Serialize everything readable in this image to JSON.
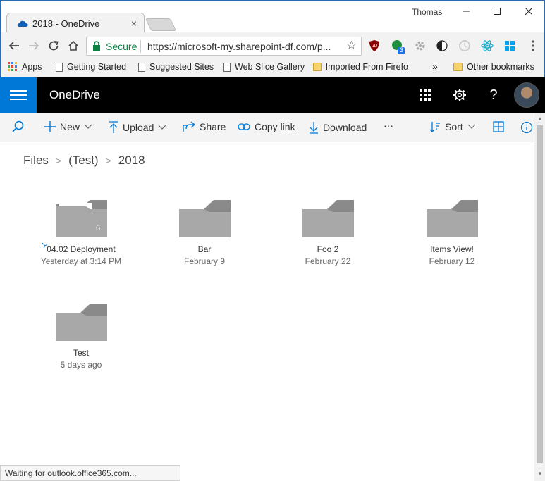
{
  "browser": {
    "tab_title": "2018 - OneDrive",
    "tab_close": "×",
    "user_name": "Thomas",
    "secure_label": "Secure",
    "url": "https://microsoft-my.sharepoint-df.com/p...",
    "bookmarks": [
      {
        "label": "Apps",
        "icon": "apps-grid-icon"
      },
      {
        "label": "Getting Started",
        "icon": "page-icon"
      },
      {
        "label": "Suggested Sites",
        "icon": "page-icon"
      },
      {
        "label": "Web Slice Gallery",
        "icon": "page-icon"
      },
      {
        "label": "Imported From Firefo",
        "icon": "folder-icon"
      }
    ],
    "bookmarks_overflow": "»",
    "other_bookmarks": "Other bookmarks",
    "extension_badge": "3",
    "status_text": "Waiting for outlook.office365.com..."
  },
  "onedrive": {
    "title": "OneDrive",
    "commands": {
      "new": "New",
      "upload": "Upload",
      "share": "Share",
      "copy_link": "Copy link",
      "download": "Download",
      "more": "···",
      "sort": "Sort"
    }
  },
  "breadcrumb": {
    "items": [
      "Files",
      "(Test)",
      "2018"
    ],
    "separator": ">"
  },
  "folders": [
    {
      "name": "04.02 Deployment",
      "date": "Yesterday at 3:14 PM",
      "count": "6",
      "has_items": true,
      "new": true
    },
    {
      "name": "Bar",
      "date": "February 9",
      "has_items": false
    },
    {
      "name": "Foo 2",
      "date": "February 22",
      "has_items": false
    },
    {
      "name": "Items View!",
      "date": "February 12",
      "has_items": false
    },
    {
      "name": "Test",
      "date": "5 days ago",
      "has_items": false
    }
  ],
  "colors": {
    "accent": "#0078d7",
    "header_bg": "#000000",
    "folder": "#a8a8a8",
    "folder_tab": "#8a8a8a",
    "secure_green": "#0b8043"
  }
}
